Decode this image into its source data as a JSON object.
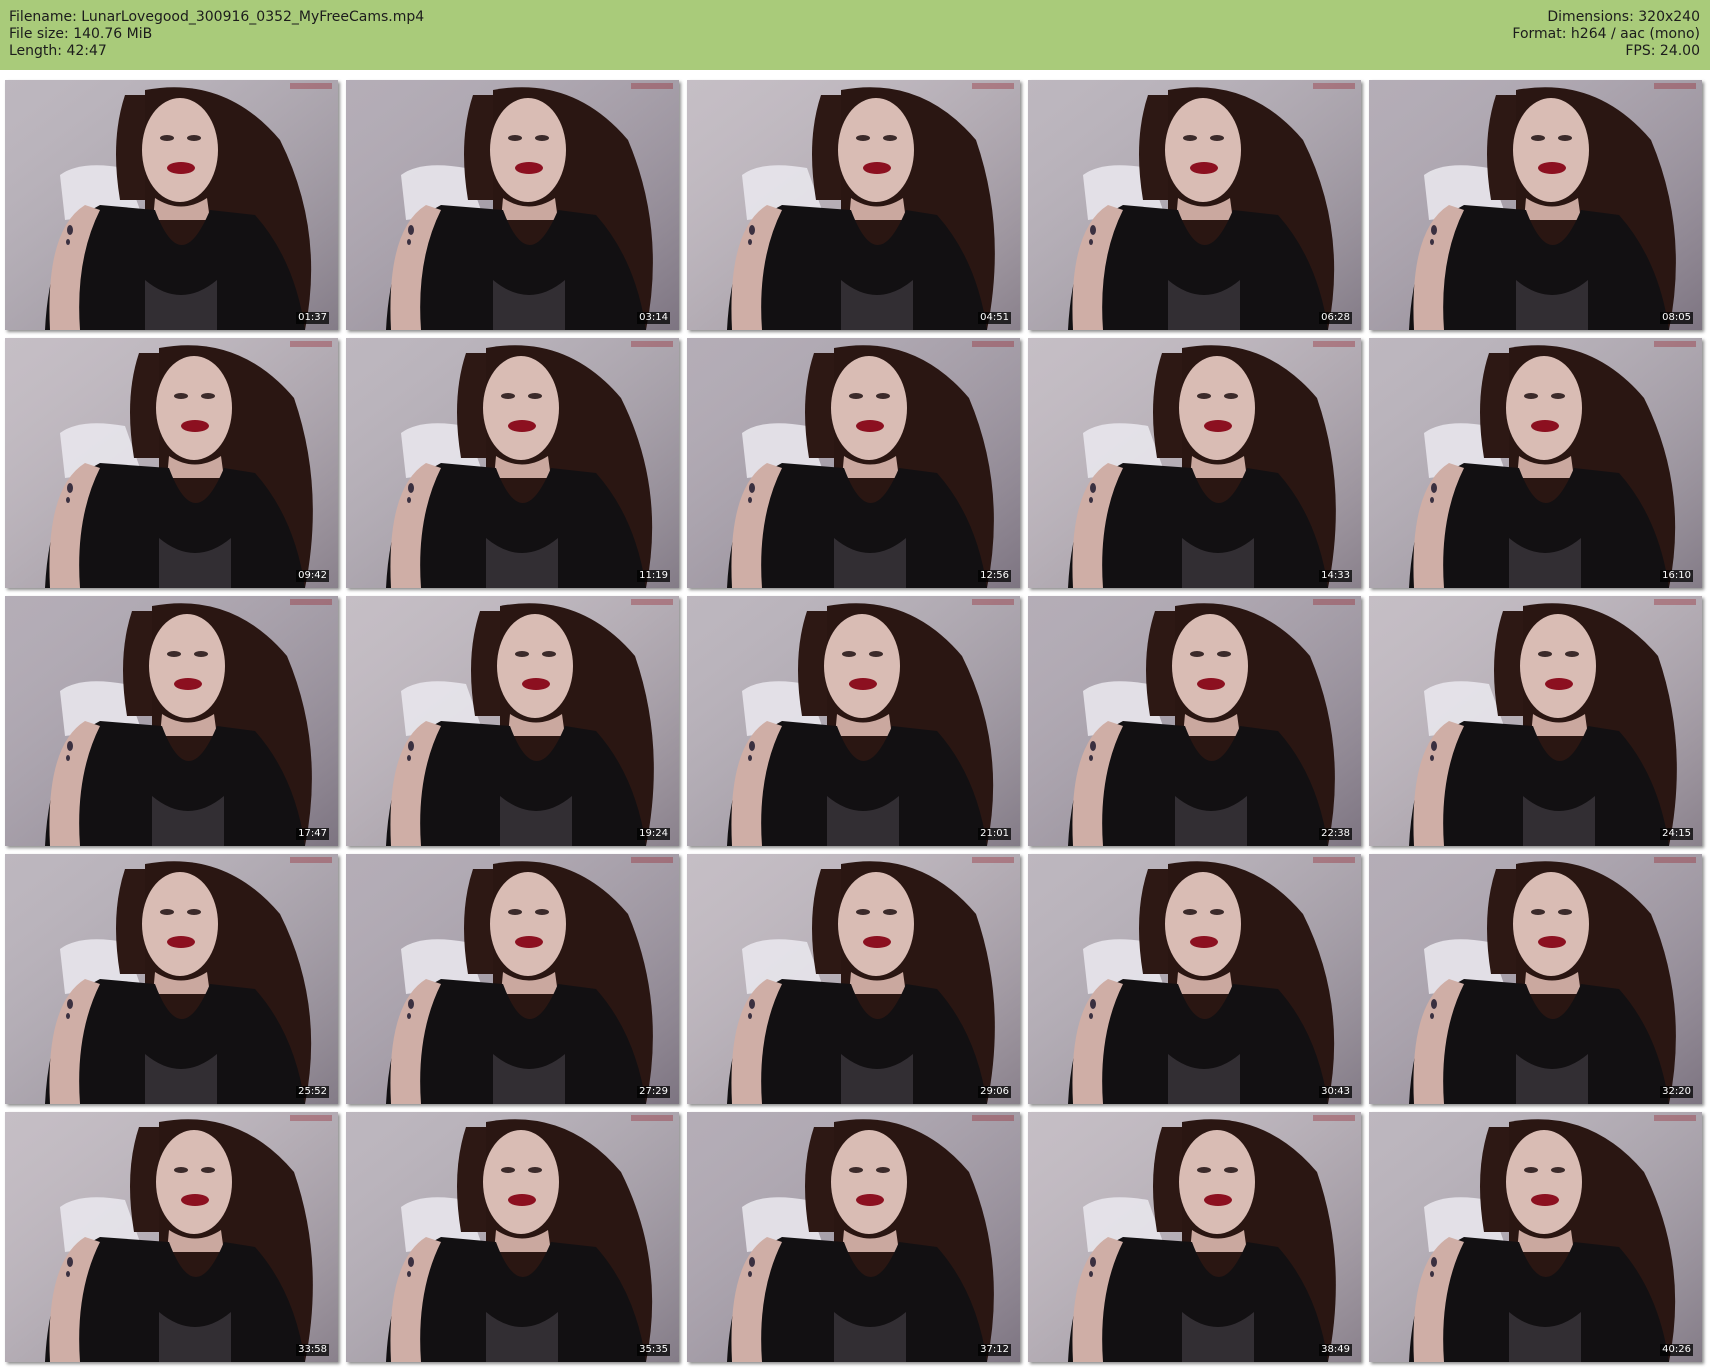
{
  "header": {
    "filename_line": "Filename: LunarLovegood_300916_0352_MyFreeCams.mp4",
    "filesize_line": "File size: 140.76 MiB",
    "length_line": "Length: 42:47",
    "dimensions_line": "Dimensions: 320x240",
    "format_line": "Format: h264 / aac (mono)",
    "fps_line": "FPS: 24.00"
  },
  "colors": {
    "header_background": "#a9cb7a",
    "page_background": "#ffffff",
    "timestamp_text": "#ffffff"
  },
  "thumbnails": [
    {
      "timestamp": "01:37"
    },
    {
      "timestamp": "03:14"
    },
    {
      "timestamp": "04:51"
    },
    {
      "timestamp": "06:28"
    },
    {
      "timestamp": "08:05"
    },
    {
      "timestamp": "09:42"
    },
    {
      "timestamp": "11:19"
    },
    {
      "timestamp": "12:56"
    },
    {
      "timestamp": "14:33"
    },
    {
      "timestamp": "16:10"
    },
    {
      "timestamp": "17:47"
    },
    {
      "timestamp": "19:24"
    },
    {
      "timestamp": "21:01"
    },
    {
      "timestamp": "22:38"
    },
    {
      "timestamp": "24:15"
    },
    {
      "timestamp": "25:52"
    },
    {
      "timestamp": "27:29"
    },
    {
      "timestamp": "29:06"
    },
    {
      "timestamp": "30:43"
    },
    {
      "timestamp": "32:20"
    },
    {
      "timestamp": "33:58"
    },
    {
      "timestamp": "35:35"
    },
    {
      "timestamp": "37:12"
    },
    {
      "timestamp": "38:49"
    },
    {
      "timestamp": "40:26"
    }
  ]
}
